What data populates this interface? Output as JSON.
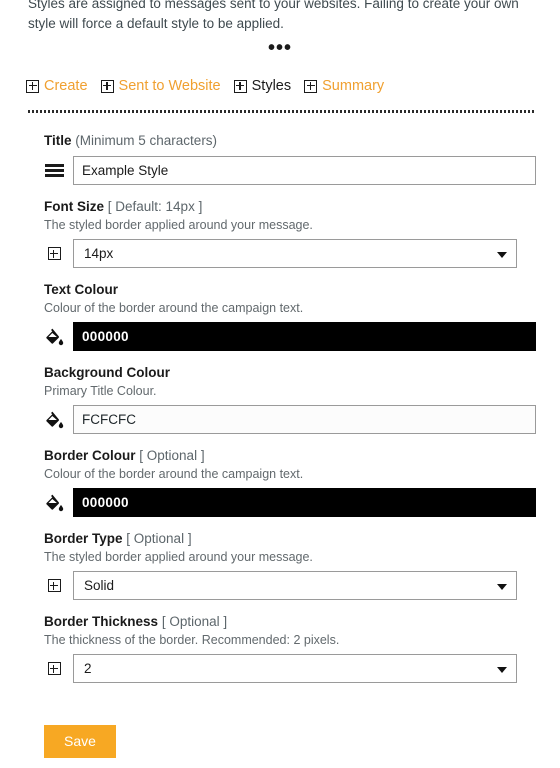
{
  "intro": {
    "text": "Styles are assigned to messages sent to your websites. Failing to create your own style will force a default style to be applied."
  },
  "divider": {
    "ellipsis": "•••"
  },
  "tabs": [
    {
      "label": "Create",
      "icon": "plus-box-icon",
      "active": false
    },
    {
      "label": "Sent to Website",
      "icon": "plus-box-icon",
      "active": false
    },
    {
      "label": "Styles",
      "icon": "plus-box-icon",
      "active": true
    },
    {
      "label": "Summary",
      "icon": "plus-box-icon",
      "active": false
    }
  ],
  "colors": {
    "accent": "#F0A030",
    "save_button": "#F7A823",
    "text_colour_swatch": "#000000",
    "background_colour_swatch": "#FCFCFC"
  },
  "form": {
    "title": {
      "label": "Title",
      "suffix": "(Minimum 5 characters)",
      "description": "",
      "icon": "hamburger-icon",
      "value": "Example Style"
    },
    "font_size": {
      "label": "Font Size",
      "suffix": "[ Default: 14px ]",
      "description": "The styled border applied around your message.",
      "icon": "plus-box-icon",
      "value": "14px",
      "options": [
        "14px"
      ]
    },
    "text_colour": {
      "label": "Text Colour",
      "suffix": "",
      "description": "Colour of the border around the campaign text.",
      "icon": "paint-bucket-icon",
      "value": "000000"
    },
    "background_colour": {
      "label": "Background Colour",
      "suffix": "",
      "description": "Primary Title Colour.",
      "icon": "paint-bucket-icon",
      "value": "FCFCFC"
    },
    "border_colour": {
      "label": "Border Colour",
      "suffix": "[ Optional ]",
      "description": "Colour of the border around the campaign text.",
      "icon": "paint-bucket-icon",
      "value": "000000"
    },
    "border_type": {
      "label": "Border Type",
      "suffix": "[ Optional ]",
      "description": "The styled border applied around your message.",
      "icon": "plus-box-icon",
      "value": "Solid",
      "options": [
        "Solid"
      ]
    },
    "border_thickness": {
      "label": "Border Thickness",
      "suffix": "[ Optional ]",
      "description": "The thickness of the border. Recommended: 2 pixels.",
      "icon": "plus-box-icon",
      "value": "2",
      "options": [
        "2"
      ]
    },
    "save_label": "Save"
  }
}
